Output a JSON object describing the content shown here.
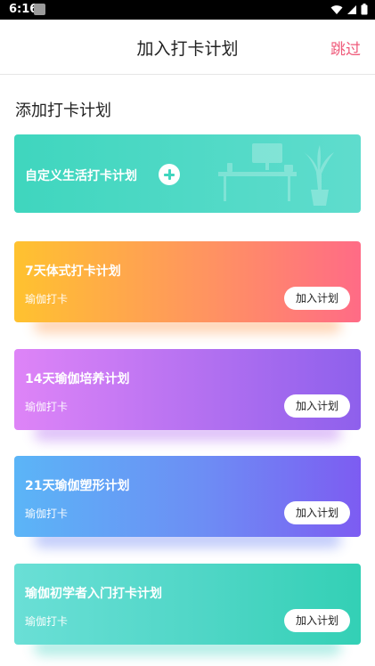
{
  "status_bar": {
    "time": "6:16"
  },
  "header": {
    "title": "加入打卡计划",
    "skip_label": "跳过"
  },
  "section": {
    "title": "添加打卡计划"
  },
  "custom_card": {
    "label": "自定义生活打卡计划"
  },
  "plans": [
    {
      "title": "7天体式打卡计划",
      "subtitle": "瑜伽打卡",
      "button_label": "加入计划"
    },
    {
      "title": "14天瑜伽培养计划",
      "subtitle": "瑜伽打卡",
      "button_label": "加入计划"
    },
    {
      "title": "21天瑜伽塑形计划",
      "subtitle": "瑜伽打卡",
      "button_label": "加入计划"
    },
    {
      "title": "瑜伽初学者入门打卡计划",
      "subtitle": "瑜伽打卡",
      "button_label": "加入计划"
    }
  ],
  "colors": {
    "accent_skip": "#ef5a7a",
    "custom_card": "#3fd6be"
  }
}
